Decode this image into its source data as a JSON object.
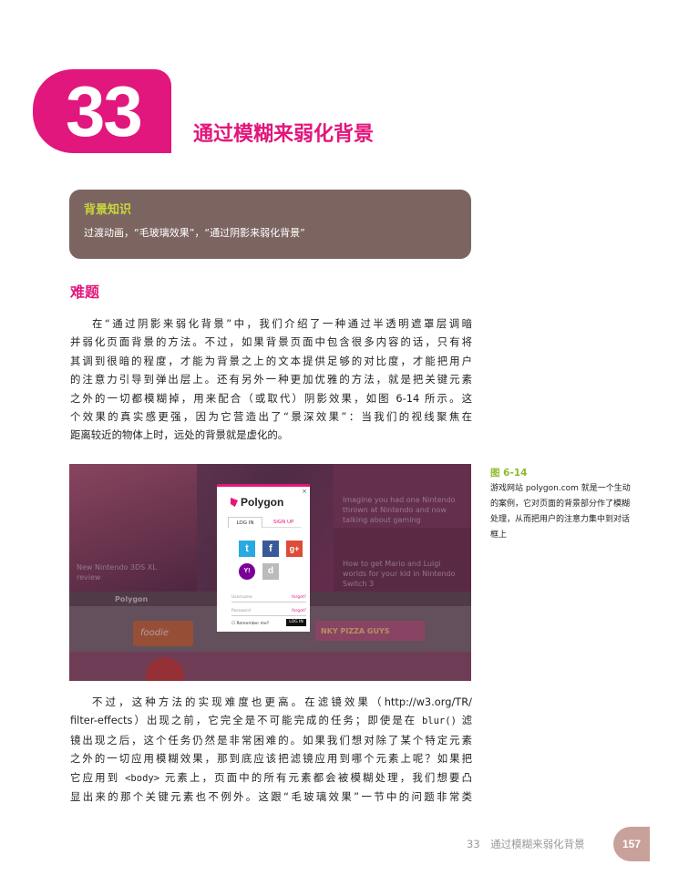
{
  "chapter": {
    "number": "33",
    "title": "通过模糊来弱化背景"
  },
  "background_box": {
    "title": "背景知识",
    "text": "过渡动画，“毛玻璃效果”，“通过阴影来弱化背景”"
  },
  "section": {
    "heading": "难题"
  },
  "paragraph1": {
    "lines": [
      "在“通过阴影来弱化背景”中，我们介绍了一种通过半透明遮罩层调暗",
      "并弱化页面背景的方法。不过，如果背景页面中包含很多内容的话，只有将",
      "其调到很暗的程度，才能为背景之上的文本提供足够的对比度，才能把用户",
      "的注意力引导到弹出层上。还有另外一种更加优雅的方法，就是把关键元素",
      "之外的一切都模糊掉，用来配合（或取代）阴影效果，如图 6-14 所示。这",
      "个效果的真实感更强，因为它营造出了“景深效果”：当我们的视线聚焦在",
      "距离较近的物体上时，远处的背景就是虚化的。"
    ]
  },
  "figure": {
    "label": "图 6-14",
    "caption": "游戏网站 polygon.com 就是一个生动的案例，它对页面的背景部分作了模糊处理，从而把用户的注意力集中到对话框上",
    "dialog": {
      "close": "×",
      "logo": "Polygon",
      "tab_login": "LOG IN",
      "tab_signup": "SIGN UP",
      "social": {
        "twitter": "t",
        "facebook": "f",
        "googleplus": "g+",
        "yahoo": "Y!",
        "disqus": "d"
      },
      "username_placeholder": "Username",
      "password_placeholder": "Password",
      "forgot1": "forgot?",
      "forgot2": "forgot?",
      "remember": "Remember me?",
      "login_button": "LOG IN"
    },
    "blurred_texts": {
      "left_headline": "New Nintendo 3DS XL review",
      "right_top": "Imagine you had one Nintendo thrown at Nintendo and now talking about gaming",
      "right_mid": "How to get Mario and Luigi worlds for your kid in Nintendo Switch 3",
      "brand": "Polygon",
      "foodie": "foodie",
      "pizza": "NKY PIZZA GUYS"
    }
  },
  "paragraph2": {
    "lines": [
      [
        "不过，这种方法的实现难度也更高。在滤镜效果（http://w3.org/TR/",
        ""
      ],
      [
        "filter-effects）出现之前，它完全是不可能完成的任务；即使是在 ",
        "blur()",
        " 滤"
      ],
      [
        "镜出现之后，这个任务仍然是非常困难的。如果我们想对除了某个特定元素",
        ""
      ],
      [
        "之外的一切应用模糊效果，那到底应该把滤镜应用到哪个元素上呢？如果把",
        ""
      ],
      [
        "它应用到 ",
        "<body>",
        " 元素上，页面中的所有元素都会被模糊处理，我们想要凸"
      ],
      [
        "显出来的那个关键元素也不例外。这跟“毛玻璃效果”一节中的问题非常类",
        ""
      ]
    ]
  },
  "footer": {
    "chapter_text": "33　通过模糊来弱化背景",
    "page_number": "157"
  },
  "colors": {
    "accent": "#e2177d",
    "box_bg": "#7c6560",
    "box_title": "#c7d93b",
    "figure_label": "#8dbb2c",
    "page_tab": "#c8a19a"
  }
}
